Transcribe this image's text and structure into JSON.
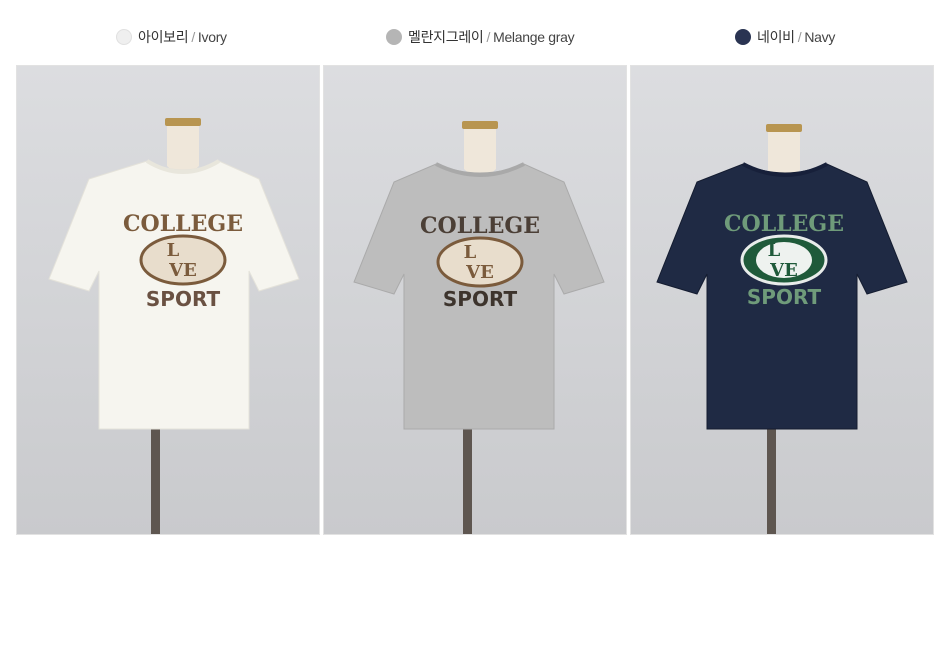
{
  "colors": [
    {
      "ko": "아이보리",
      "separator": "/",
      "en": "Ivory",
      "dot": "#efefef",
      "shirt": "#f6f5ef",
      "print": "#7b5b3c",
      "print_alt": "#7b5b3c"
    },
    {
      "ko": "멜란지그레이",
      "separator": "/",
      "en": "Melange gray",
      "dot": "#b5b5b5",
      "shirt": "#bdbdbd",
      "print": "#4b3f36",
      "print_alt": "#7b5b3c"
    },
    {
      "ko": "네이비",
      "separator": "/",
      "en": "Navy",
      "dot": "#2a3452",
      "shirt": "#1f2a44",
      "print": "#6f9b7a",
      "print_alt": "#1f5a3a"
    }
  ],
  "graphic": {
    "line1": "COLLEGE",
    "line2a": "L",
    "line2b": "VE",
    "line3": "SPORT"
  }
}
